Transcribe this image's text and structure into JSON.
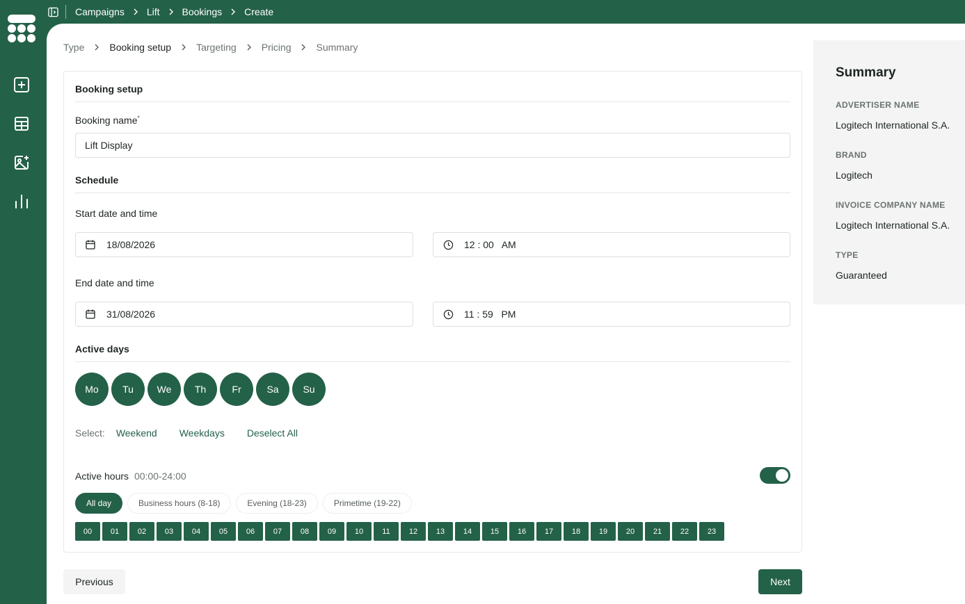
{
  "topbar": {
    "breadcrumbs": [
      "Campaigns",
      "Lift",
      "Bookings",
      "Create"
    ]
  },
  "steps": [
    "Type",
    "Booking setup",
    "Targeting",
    "Pricing",
    "Summary"
  ],
  "form": {
    "section_title": "Booking setup",
    "booking_name_label": "Booking name",
    "booking_name_required": "*",
    "booking_name_value": "Lift Display",
    "schedule_title": "Schedule",
    "start_label": "Start date and time",
    "start_date": "18/08/2026",
    "start_time": "12 : 00   AM",
    "end_label": "End date and time",
    "end_date": "31/08/2026",
    "end_time": "11 : 59   PM",
    "active_days_title": "Active days",
    "days": [
      "Mo",
      "Tu",
      "We",
      "Th",
      "Fr",
      "Sa",
      "Su"
    ],
    "select_label": "Select:",
    "select_weekend": "Weekend",
    "select_weekdays": "Weekdays",
    "select_deselect": "Deselect All",
    "active_hours_label": "Active hours",
    "active_hours_range": "00:00-24:00",
    "presets": [
      "All day",
      "Business hours (8-18)",
      "Evening (18-23)",
      "Primetime (19-22)"
    ],
    "hours": [
      "00",
      "01",
      "02",
      "03",
      "04",
      "05",
      "06",
      "07",
      "08",
      "09",
      "10",
      "11",
      "12",
      "13",
      "14",
      "15",
      "16",
      "17",
      "18",
      "19",
      "20",
      "21",
      "22",
      "23"
    ]
  },
  "actions": {
    "previous": "Previous",
    "next": "Next"
  },
  "summary": {
    "title": "Summary",
    "advertiser_label": "ADVERTISER NAME",
    "advertiser_value": "Logitech International S.A.",
    "brand_label": "BRAND",
    "brand_value": "Logitech",
    "invoice_label": "INVOICE COMPANY NAME",
    "invoice_value": "Logitech International S.A.",
    "type_label": "TYPE",
    "type_value": "Guaranteed"
  },
  "colors": {
    "brand": "#246149",
    "surface": "#ffffff",
    "panel": "#f3f4f3"
  }
}
